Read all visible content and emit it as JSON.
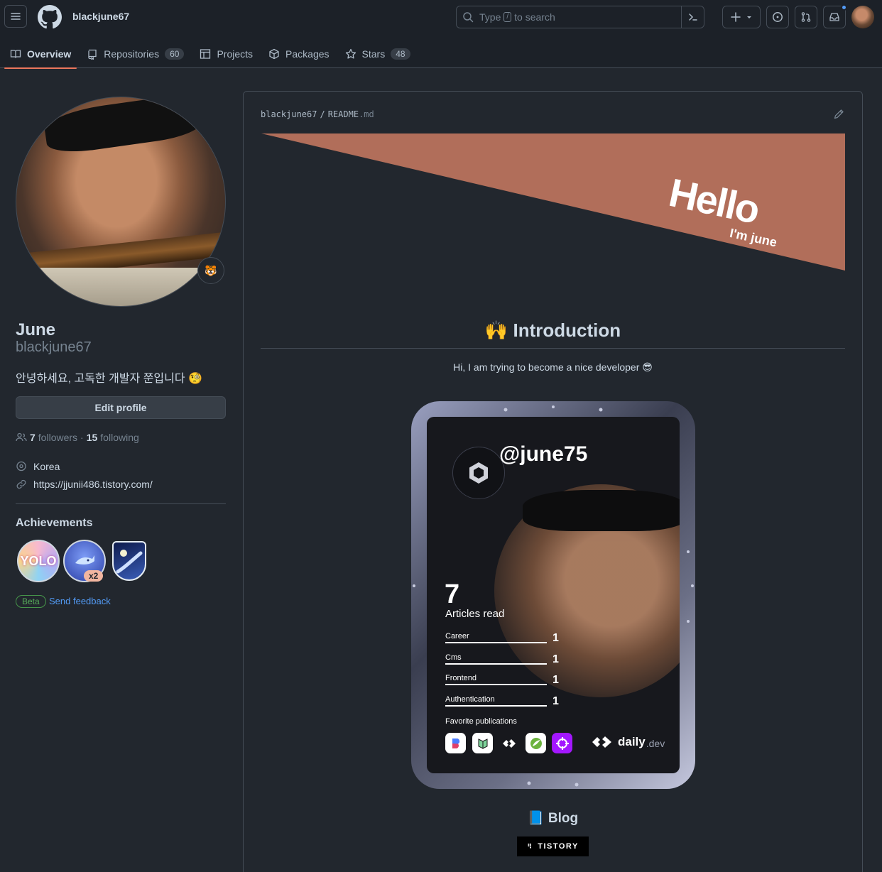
{
  "header": {
    "owner": "blackjune67",
    "search_text_before": "Type",
    "search_key": "/",
    "search_text_after": "to search"
  },
  "tabs": [
    {
      "label": "Overview",
      "count": "",
      "active": true
    },
    {
      "label": "Repositories",
      "count": "60",
      "active": false
    },
    {
      "label": "Projects",
      "count": "",
      "active": false
    },
    {
      "label": "Packages",
      "count": "",
      "active": false
    },
    {
      "label": "Stars",
      "count": "48",
      "active": false
    }
  ],
  "profile": {
    "status_emoji": "🐯",
    "name": "June",
    "login": "blackjune67",
    "bio": "안녕하세요, 고독한 개발자 쭌입니다 🧐",
    "edit_label": "Edit profile",
    "followers_count": "7",
    "followers_label": "followers",
    "separator": "·",
    "following_count": "15",
    "following_label": "following",
    "location": "Korea",
    "website": "https://jjunii486.tistory.com/"
  },
  "achievements": {
    "title": "Achievements",
    "yolo": "YOLO",
    "shark_multiplier": "x2",
    "beta": "Beta",
    "feedback": "Send feedback"
  },
  "readme": {
    "path_owner": "blackjune67",
    "path_sep": "/",
    "path_file": "README",
    "path_ext": ".md",
    "banner_title": "Hello",
    "banner_subtitle": "I'm june",
    "intro_heading": "🙌 Introduction",
    "intro_text": "Hi, I am trying to become a nice developer 😎",
    "blog_heading": "📘 Blog",
    "tistory_label": "TISTORY"
  },
  "devcard": {
    "handle": "@june75",
    "articles_read": "7",
    "articles_label": "Articles read",
    "tags": [
      {
        "name": "Career",
        "value": "1"
      },
      {
        "name": "Cms",
        "value": "1"
      },
      {
        "name": "Frontend",
        "value": "1"
      },
      {
        "name": "Authentication",
        "value": "1"
      }
    ],
    "favorite_label": "Favorite publications",
    "brand_main": "daily",
    "brand_suffix": ".dev"
  },
  "colors": {
    "accent": "#ec775c",
    "banner": "#b16e5a",
    "link": "#539bf5",
    "bg": "#22272e"
  }
}
